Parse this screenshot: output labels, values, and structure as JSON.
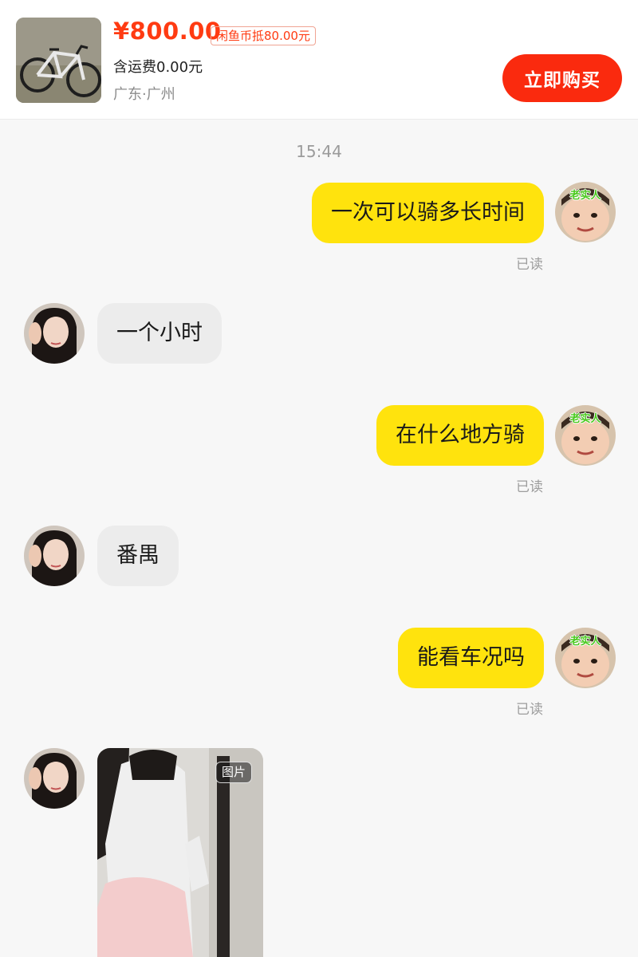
{
  "product": {
    "image_icon": "bicycle-photo",
    "price": "¥800.00",
    "coin_discount": "闲鱼币抵80.00元",
    "shipping": "含运费0.00元",
    "location": "广东·广州",
    "buy_label": "立即购买"
  },
  "chat": {
    "timestamp": "15:44",
    "me_avatar_label": "老实人",
    "messages": [
      {
        "from": "me",
        "text": "一次可以骑多长时间",
        "status": "已读"
      },
      {
        "from": "them",
        "text": "一个小时"
      },
      {
        "from": "me",
        "text": "在什么地方骑",
        "status": "已读"
      },
      {
        "from": "them",
        "text": "番禺"
      },
      {
        "from": "me",
        "text": "能看车况吗",
        "status": "已读"
      },
      {
        "from": "them",
        "type": "image",
        "tag": "图片"
      }
    ]
  },
  "colors": {
    "price_red": "#ff3b12",
    "buy_button": "#fa2a0e",
    "my_bubble": "#ffe30d",
    "their_bubble": "#ececec"
  }
}
